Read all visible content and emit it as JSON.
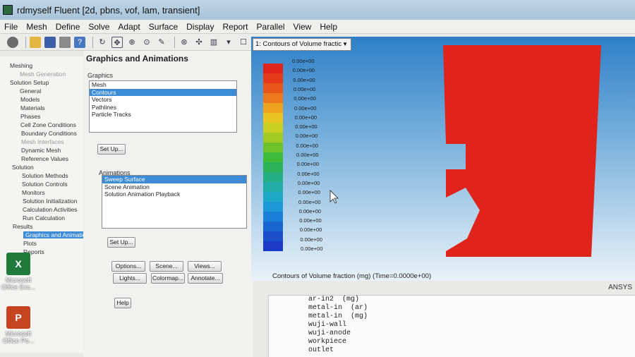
{
  "window": {
    "title": "rdmyself Fluent  [2d, pbns, vof, lam, transient]"
  },
  "menu": [
    "File",
    "Mesh",
    "Define",
    "Solve",
    "Adapt",
    "Surface",
    "Display",
    "Report",
    "Parallel",
    "View",
    "Help"
  ],
  "desktop_icons": [
    {
      "label": "Microsoft Office Exc...",
      "color": "#1f7a3c",
      "glyph": "X"
    },
    {
      "label": "Microsoft Office Po...",
      "color": "#c6441f",
      "glyph": "P"
    }
  ],
  "navigation": [
    {
      "label": "Meshing",
      "indent": 0,
      "state": "normal"
    },
    {
      "label": "Mesh Generation",
      "indent": 1,
      "state": "dim"
    },
    {
      "label": "Solution Setup",
      "indent": 0,
      "state": "normal"
    },
    {
      "label": "General",
      "indent": 1,
      "state": "normal"
    },
    {
      "label": "Models",
      "indent": 1,
      "state": "normal"
    },
    {
      "label": "Materials",
      "indent": 1,
      "state": "normal"
    },
    {
      "label": "Phases",
      "indent": 1,
      "state": "normal"
    },
    {
      "label": "Cell Zone Conditions",
      "indent": 1,
      "state": "normal"
    },
    {
      "label": "Boundary Conditions",
      "indent": 1,
      "state": "normal"
    },
    {
      "label": "Mesh Interfaces",
      "indent": 1,
      "state": "dim"
    },
    {
      "label": "Dynamic Mesh",
      "indent": 1,
      "state": "normal"
    },
    {
      "label": "Reference Values",
      "indent": 1,
      "state": "normal"
    },
    {
      "label": "Solution",
      "indent": 0,
      "state": "normal"
    },
    {
      "label": "Solution Methods",
      "indent": 1,
      "state": "normal"
    },
    {
      "label": "Solution Controls",
      "indent": 1,
      "state": "normal"
    },
    {
      "label": "Monitors",
      "indent": 1,
      "state": "normal"
    },
    {
      "label": "Solution Initialization",
      "indent": 1,
      "state": "normal"
    },
    {
      "label": "Calculation Activities",
      "indent": 1,
      "state": "normal"
    },
    {
      "label": "Run Calculation",
      "indent": 1,
      "state": "normal"
    },
    {
      "label": "Results",
      "indent": 0,
      "state": "normal"
    },
    {
      "label": "Graphics and Animations",
      "indent": 1,
      "state": "selected"
    },
    {
      "label": "Plots",
      "indent": 1,
      "state": "normal"
    },
    {
      "label": "Reports",
      "indent": 1,
      "state": "normal"
    }
  ],
  "task": {
    "heading": "Graphics and Animations",
    "graphics_label": "Graphics",
    "graphics_items": [
      "Mesh",
      "Contours",
      "Vectors",
      "Pathlines",
      "Particle Tracks"
    ],
    "graphics_selected": "Contours",
    "setup_label": "Set Up...",
    "animations_label": "Animations",
    "animation_items": [
      "Sweep Surface",
      "Scene Animation",
      "Solution Animation Playback"
    ],
    "animation_selected": "Sweep Surface",
    "setup2_label": "Set Up...",
    "options_label": "Options...",
    "scene_label": "Scene...",
    "views_label": "Views...",
    "lights_label": "Lights...",
    "colormap_label": "Colormap...",
    "annotate_label": "Annotate...",
    "help_label": "Help"
  },
  "graphics_window": {
    "dropdown": "1: Contours of Volume fractic",
    "legend_values": [
      "0.00e+00",
      "0.00e+00",
      "0.00e+00",
      "0.00e+00",
      "0.00e+00",
      "0.00e+00",
      "0.00e+00",
      "0.00e+00",
      "0.00e+00",
      "0.00e+00",
      "0.00e+00",
      "0.00e+00",
      "0.00e+00",
      "0.00e+00",
      "0.00e+00",
      "0.00e+00",
      "0.00e+00",
      "0.00e+00",
      "0.00e+00",
      "0.00e+00",
      "0.00e+00"
    ],
    "legend_colors": [
      "#e0241c",
      "#e43a1a",
      "#e8561a",
      "#ec7a1c",
      "#eea21e",
      "#e8c420",
      "#c9cf21",
      "#9fcb24",
      "#6ec32a",
      "#3fbb3a",
      "#2cb35a",
      "#25ae82",
      "#22aca8",
      "#1da8c6",
      "#1c98d6",
      "#1a7fd6",
      "#1a66d0",
      "#1a4ecb",
      "#1b3ac6"
    ],
    "caption": "Contours of Volume fraction (mg)  (Time=0.0000e+00)",
    "brand": "ANSYS",
    "domain_color": "#e0241c"
  },
  "console": {
    "lines": [
      "ar-in2  (mg)",
      "metal-in  (ar)",
      "metal-in  (mg)",
      "wuji-wall",
      "wuji-anode",
      "workpiece",
      "outlet"
    ]
  }
}
